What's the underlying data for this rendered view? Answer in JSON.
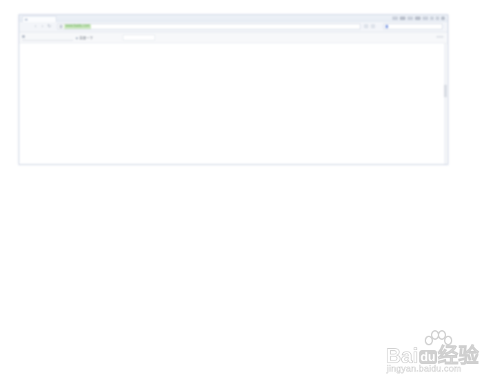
{
  "browser": {
    "address_url": "www.baidu.com",
    "icons": {
      "back": "back-arrow-icon",
      "forward": "forward-arrow-icon",
      "refresh": "refresh-icon",
      "lock": "page-icon",
      "search_engine": "paw-icon"
    },
    "bookmarks": {
      "item_label": "百度一下"
    },
    "colors": {
      "address_highlight": "#cfe9c2",
      "url_text": "#5aa649",
      "frame": "#cfd6e4"
    }
  },
  "watermark": {
    "logo_text_a": "Bai",
    "logo_text_du": "du",
    "logo_text_b": "经验",
    "url": "jingyan.baidu.com"
  }
}
